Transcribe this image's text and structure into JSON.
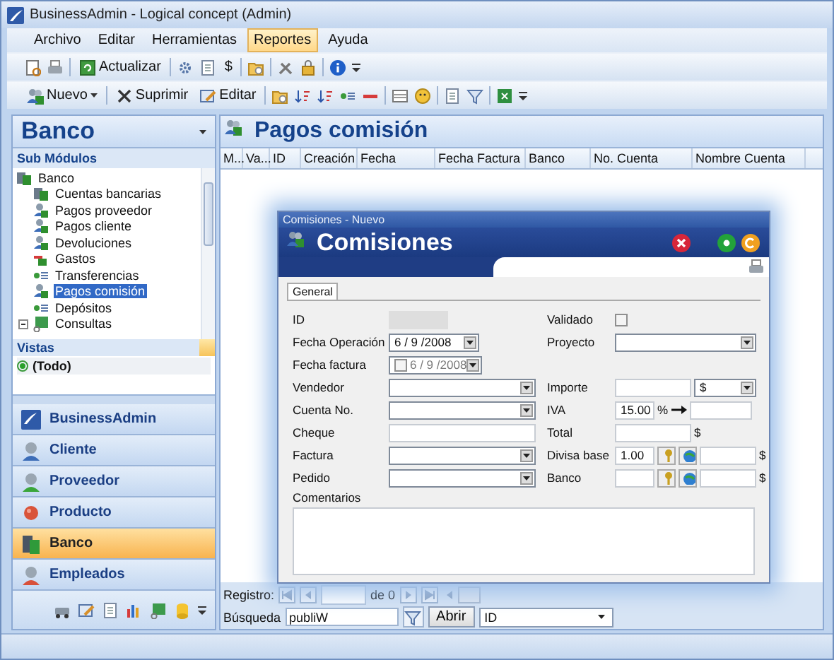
{
  "window": {
    "title": "BusinessAdmin - Logical concept (Admin)"
  },
  "menu": [
    {
      "label": "Archivo",
      "selected": false
    },
    {
      "label": "Editar",
      "selected": false
    },
    {
      "label": "Herramientas",
      "selected": false
    },
    {
      "label": "Reportes",
      "selected": true
    },
    {
      "label": "Ayuda",
      "selected": false
    }
  ],
  "toolbar_1": {
    "refresh": "Actualizar",
    "currency": "$"
  },
  "toolbar_2": {
    "new": "Nuevo",
    "delete": "Suprimir",
    "edit": "Editar"
  },
  "module_panel": {
    "title": "Banco",
    "submodules_heading": "Sub Módulos",
    "tree": [
      {
        "label": "Banco",
        "selected": false,
        "children": [
          {
            "label": "Cuentas bancarias",
            "selected": false
          },
          {
            "label": "Pagos proveedor",
            "selected": false
          },
          {
            "label": "Pagos cliente",
            "selected": false
          },
          {
            "label": "Devoluciones",
            "selected": false
          },
          {
            "label": "Gastos",
            "selected": false
          },
          {
            "label": "Transferencias",
            "selected": false
          },
          {
            "label": "Pagos comisión",
            "selected": true
          },
          {
            "label": "Depósitos",
            "selected": false
          }
        ]
      },
      {
        "label": "Consultas",
        "selected": false,
        "expanded": true
      }
    ],
    "views_heading": "Vistas",
    "views": [
      {
        "label": "(Todo)",
        "selected": true
      }
    ]
  },
  "nav": [
    {
      "label": "BusinessAdmin",
      "selected": false
    },
    {
      "label": "Cliente",
      "selected": false
    },
    {
      "label": "Proveedor",
      "selected": false
    },
    {
      "label": "Producto",
      "selected": false
    },
    {
      "label": "Banco",
      "selected": true
    },
    {
      "label": "Empleados",
      "selected": false
    }
  ],
  "list": {
    "title": "Pagos comisión",
    "columns": [
      "M...",
      "Va...",
      "ID",
      "Creación",
      "Fecha",
      "Fecha Factura",
      "Banco",
      "No. Cuenta",
      "Nombre Cuenta"
    ]
  },
  "navigator": {
    "label": "Registro:",
    "count": "de 0"
  },
  "search": {
    "label": "Búsqueda",
    "value": "publiW",
    "open_button": "Abrir",
    "field": "ID"
  },
  "dialog": {
    "window_title": "Comisiones - Nuevo",
    "title": "Comisiones",
    "tabs": [
      {
        "label": "General",
        "selected": true
      }
    ],
    "left_fields": [
      {
        "label": "ID",
        "kind": "readonly"
      },
      {
        "label": "Fecha Operación",
        "kind": "date",
        "value": "6 / 9 /2008"
      },
      {
        "label": "Fecha factura",
        "kind": "date_check",
        "value": "6 / 9 /2008",
        "checked": false
      },
      {
        "label": "Vendedor",
        "kind": "combo"
      },
      {
        "label": "Cuenta No.",
        "kind": "combo"
      },
      {
        "label": "Cheque",
        "kind": "text"
      },
      {
        "label": "Factura",
        "kind": "combo"
      },
      {
        "label": "Pedido",
        "kind": "combo"
      }
    ],
    "right_fields": [
      {
        "label": "Validado",
        "kind": "checkbox",
        "checked": false
      },
      {
        "label": "Proyecto",
        "kind": "combo"
      },
      {
        "kind": "blank"
      },
      {
        "label": "Importe",
        "kind": "amount_currency",
        "currency": "$"
      },
      {
        "label": "IVA",
        "kind": "percent",
        "value": "15.00",
        "unit": "%"
      },
      {
        "label": "Total",
        "kind": "amount_unit",
        "unit": "$"
      },
      {
        "label": "Divisa base",
        "kind": "rate",
        "value": "1.00",
        "unit": "$"
      },
      {
        "label": "Banco",
        "kind": "rate",
        "unit": "$"
      }
    ],
    "comments_label": "Comentarios"
  }
}
